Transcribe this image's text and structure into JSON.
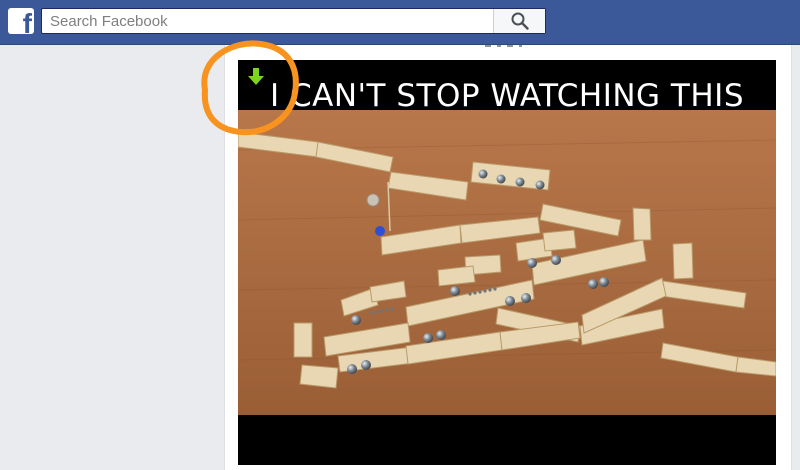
{
  "topbar": {
    "logo_letter": "f",
    "logo_icon": "facebook-logo",
    "search": {
      "placeholder": "Search Facebook",
      "value": ""
    },
    "search_icon": "magnifier-icon"
  },
  "post": {
    "video": {
      "title_overlay": "I CAN'T STOP WATCHING THIS",
      "download_icon": "green-down-arrow-icon"
    }
  },
  "annotation": {
    "color": "#f7931e",
    "shape": "ring"
  },
  "colors": {
    "brand": "#3b5998",
    "background": "#e9ebee",
    "table": "#a9683e",
    "arrow": "#7ed321"
  }
}
